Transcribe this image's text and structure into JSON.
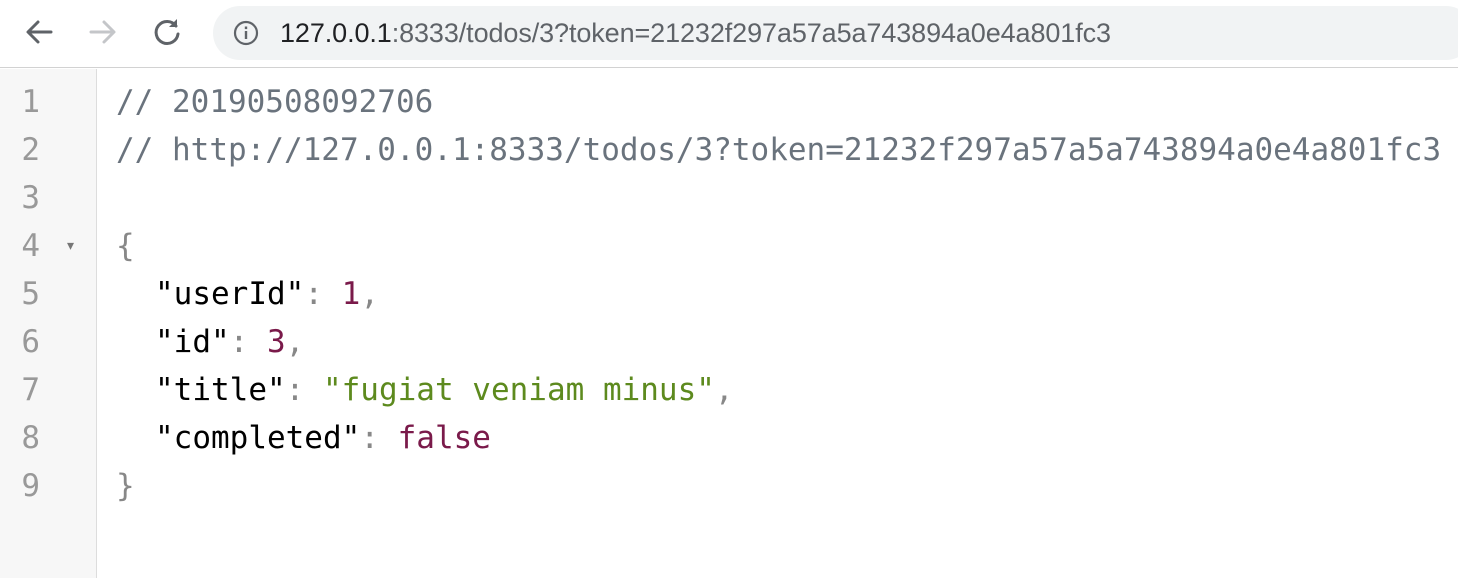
{
  "browser": {
    "url_host": "127.0.0.1",
    "url_rest": ":8333/todos/3?token=21232f297a57a5a743894a0e4a801fc3",
    "icons": {
      "back": "arrow-left-icon",
      "forward": "arrow-right-icon",
      "reload": "reload-icon",
      "info": "info-circle-icon"
    }
  },
  "viewer": {
    "line_numbers": [
      "1",
      "2",
      "3",
      "4",
      "5",
      "6",
      "7",
      "8",
      "9"
    ],
    "fold_marker": "▾",
    "comment1": "// 20190508092706",
    "comment2": "// http://127.0.0.1:8333/todos/3?token=21232f297a57a5a743894a0e4a801fc3",
    "open_brace": "{",
    "close_brace": "}",
    "fields": [
      {
        "key": "\"userId\"",
        "value": "1",
        "trail": ","
      },
      {
        "key": "\"id\"",
        "value": "3",
        "trail": ","
      },
      {
        "key": "\"title\"",
        "value": "\"fugiat veniam minus\"",
        "trail": ","
      },
      {
        "key": "\"completed\"",
        "value": "false",
        "trail": ""
      }
    ]
  },
  "colors": {
    "comment": "#6a737d",
    "number": "#7a1a4a",
    "string": "#5d8a1e",
    "gutter_bg": "#f7f7f7"
  }
}
